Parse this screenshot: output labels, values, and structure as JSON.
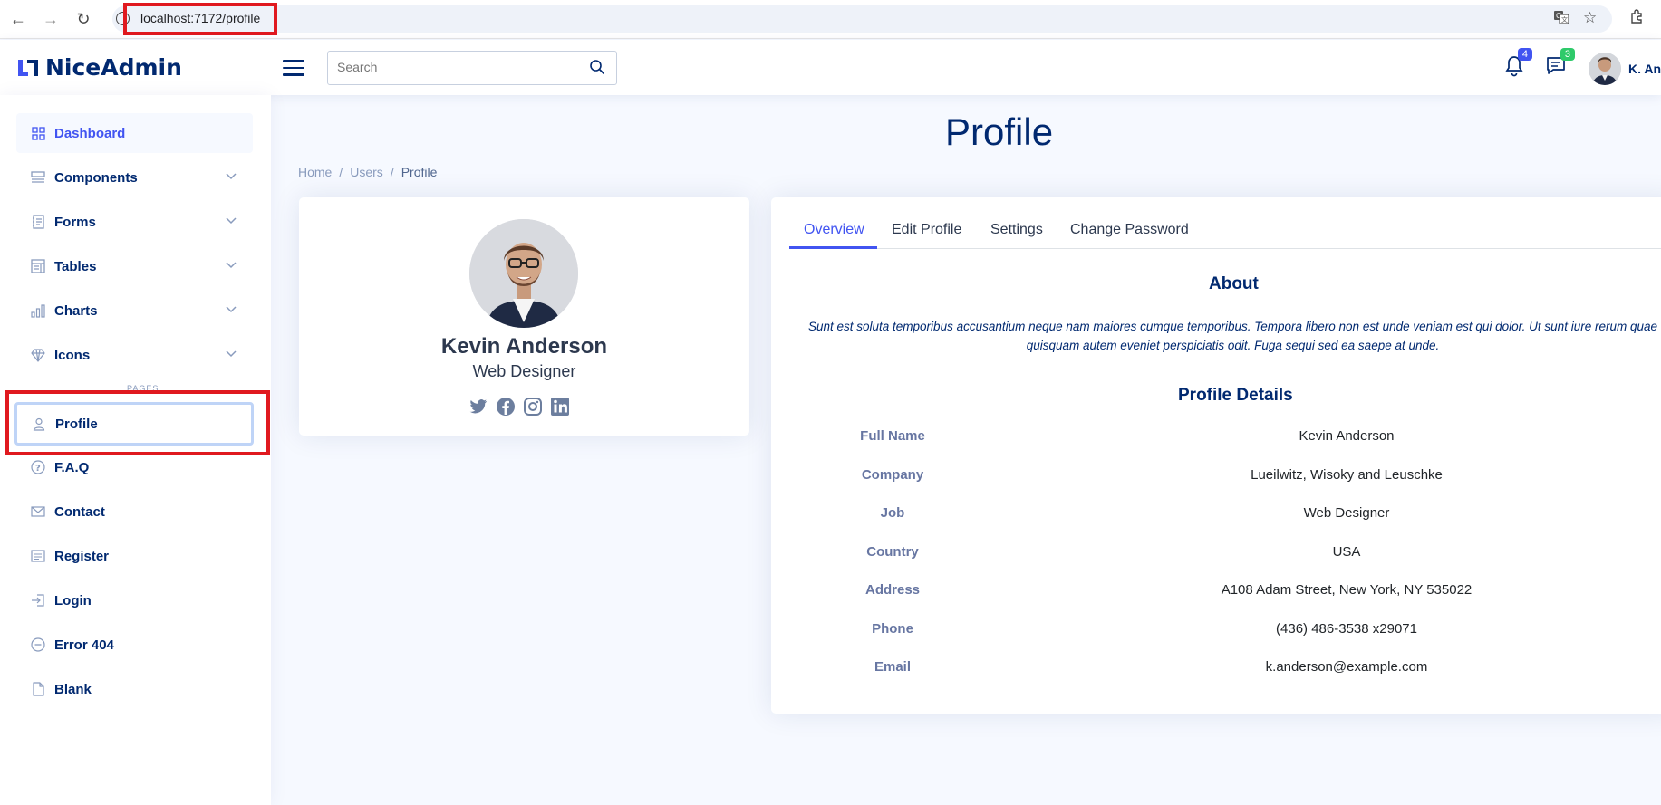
{
  "browser": {
    "url": "localhost:7172/profile"
  },
  "header": {
    "logo_text": "NiceAdmin",
    "search_placeholder": "Search",
    "notifications_count": "4",
    "messages_count": "3",
    "user_name": "K. Anderson"
  },
  "sidebar": {
    "items": [
      {
        "label": "Dashboard",
        "icon": "grid-icon"
      },
      {
        "label": "Components",
        "icon": "menu-button-icon"
      },
      {
        "label": "Forms",
        "icon": "journal-text-icon"
      },
      {
        "label": "Tables",
        "icon": "layout-text-window-icon"
      },
      {
        "label": "Charts",
        "icon": "bar-chart-icon"
      },
      {
        "label": "Icons",
        "icon": "gem-icon"
      }
    ],
    "pages_heading": "PAGES",
    "pages": [
      {
        "label": "Profile",
        "icon": "person-icon"
      },
      {
        "label": "F.A.Q",
        "icon": "question-circle-icon"
      },
      {
        "label": "Contact",
        "icon": "envelope-icon"
      },
      {
        "label": "Register",
        "icon": "card-list-icon"
      },
      {
        "label": "Login",
        "icon": "box-arrow-in-right-icon"
      },
      {
        "label": "Error 404",
        "icon": "dash-circle-icon"
      },
      {
        "label": "Blank",
        "icon": "file-icon"
      }
    ]
  },
  "page": {
    "title": "Profile",
    "breadcrumb": [
      "Home",
      "Users",
      "Profile"
    ]
  },
  "profile_card": {
    "name": "Kevin Anderson",
    "job": "Web Designer",
    "social": [
      "twitter-icon",
      "facebook-icon",
      "instagram-icon",
      "linkedin-icon"
    ]
  },
  "tabs": [
    "Overview",
    "Edit Profile",
    "Settings",
    "Change Password"
  ],
  "overview": {
    "about_title": "About",
    "about_text_line1": "Sunt est soluta temporibus accusantium neque nam maiores cumque temporibus. Tempora libero non est unde veniam est qui dolor. Ut sunt iure rerum quae",
    "about_text_line2": "quisquam autem eveniet perspiciatis odit. Fuga sequi sed ea saepe at unde.",
    "details_title": "Profile Details",
    "details": [
      {
        "label": "Full Name",
        "value": "Kevin Anderson"
      },
      {
        "label": "Company",
        "value": "Lueilwitz, Wisoky and Leuschke"
      },
      {
        "label": "Job",
        "value": "Web Designer"
      },
      {
        "label": "Country",
        "value": "USA"
      },
      {
        "label": "Address",
        "value": "A108 Adam Street, New York, NY 535022"
      },
      {
        "label": "Phone",
        "value": "(436) 486-3538 x29071"
      },
      {
        "label": "Email",
        "value": "k.anderson@example.com"
      }
    ]
  },
  "colors": {
    "primary": "#4154f1",
    "navy": "#012970",
    "background": "#f6f9ff",
    "highlight": "#e0191f"
  }
}
